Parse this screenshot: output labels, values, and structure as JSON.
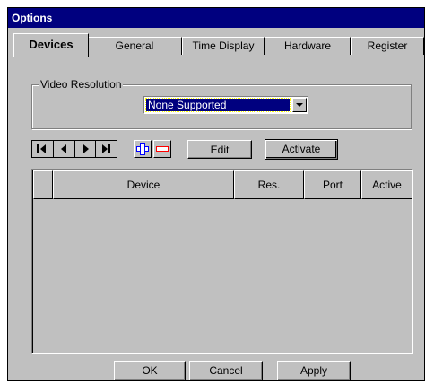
{
  "window": {
    "title": "Options"
  },
  "tabs": [
    {
      "label": "Devices",
      "active": true
    },
    {
      "label": "General",
      "active": false
    },
    {
      "label": "Time Display",
      "active": false
    },
    {
      "label": "Hardware",
      "active": false
    },
    {
      "label": "Register",
      "active": false
    }
  ],
  "video_resolution": {
    "legend": "Video Resolution",
    "selected": "None Supported"
  },
  "toolbar": {
    "nav_icons": [
      "first-record-icon",
      "previous-record-icon",
      "next-record-icon",
      "last-record-icon"
    ],
    "add_icon": "plus-icon",
    "remove_icon": "minus-icon",
    "edit_label": "Edit",
    "activate_label": "Activate"
  },
  "device_table": {
    "columns": [
      "Device",
      "Res.",
      "Port",
      "Active"
    ],
    "rows": []
  },
  "buttons": {
    "ok_label": "OK",
    "cancel_label": "Cancel",
    "apply_label": "Apply"
  },
  "colors": {
    "title_bar": "#00007f",
    "face": "#c0c0c0",
    "selection": "#00007f",
    "add_icon": "#0000ff",
    "remove_icon": "#ff0000"
  }
}
